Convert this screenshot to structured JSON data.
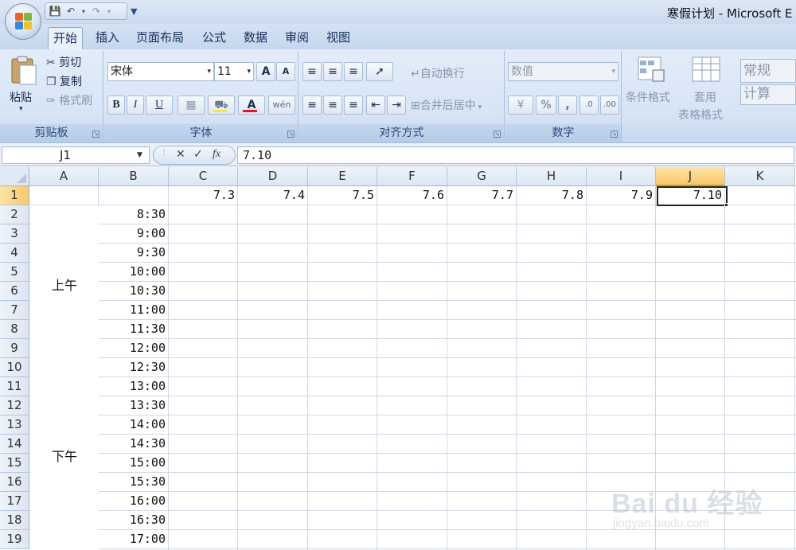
{
  "window": {
    "title": "寒假计划 - Microsoft E"
  },
  "quick_access": {
    "icons": [
      "save-icon",
      "undo-icon",
      "redo-icon",
      "customize-icon"
    ]
  },
  "tabs": [
    {
      "label": "开始",
      "active": true
    },
    {
      "label": "插入"
    },
    {
      "label": "页面布局"
    },
    {
      "label": "公式"
    },
    {
      "label": "数据"
    },
    {
      "label": "审阅"
    },
    {
      "label": "视图"
    }
  ],
  "ribbon": {
    "clipboard": {
      "label": "剪贴板",
      "paste": "粘贴",
      "cut": "剪切",
      "copy": "复制",
      "format_painter": "格式刷"
    },
    "font": {
      "label": "字体",
      "font_name": "宋体",
      "font_size": "11",
      "bold": "B",
      "italic": "I",
      "underline": "U",
      "grow": "A",
      "shrink": "A",
      "font_color": "A",
      "phonetic": "wén"
    },
    "alignment": {
      "label": "对齐方式",
      "wrap_text": "自动换行",
      "merge_center": "合并后居中"
    },
    "number": {
      "label": "数字",
      "format": "数值",
      "percent": "%",
      "comma": ","
    },
    "styles": {
      "conditional_format": "条件格式",
      "format_table_1": "套用",
      "format_table_2": "表格格式",
      "style_normal": "常规",
      "style_calc": "计算"
    }
  },
  "formula_bar": {
    "name_box": "J1",
    "formula": "7.10",
    "fx": "fx"
  },
  "colors": {
    "selected_header": "#f8c86b",
    "ribbon_bg": "#d6e4f5",
    "accent": "#15305c"
  },
  "grid": {
    "columns": [
      "A",
      "B",
      "C",
      "D",
      "E",
      "F",
      "G",
      "H",
      "I",
      "J",
      "K"
    ],
    "selected_column": "J",
    "rows": [
      "1",
      "2",
      "3",
      "4",
      "5",
      "6",
      "7",
      "8",
      "9",
      "10",
      "11",
      "12",
      "13",
      "14",
      "15",
      "16",
      "17",
      "18",
      "19"
    ],
    "selected_row": "1",
    "row1_dates": [
      "7.3",
      "7.4",
      "7.5",
      "7.6",
      "7.7",
      "7.8",
      "7.9",
      "7.10"
    ],
    "times": [
      "8:30",
      "9:00",
      "9:30",
      "10:00",
      "10:30",
      "11:00",
      "11:30",
      "12:00",
      "12:30",
      "13:00",
      "13:30",
      "14:00",
      "14:30",
      "15:00",
      "15:30",
      "16:00",
      "16:30",
      "17:00"
    ],
    "merged_labels": {
      "morning": "上午",
      "afternoon": "下午"
    }
  },
  "watermark": {
    "brand": "Bai du 经验",
    "url": "jingyan.baidu.com"
  }
}
